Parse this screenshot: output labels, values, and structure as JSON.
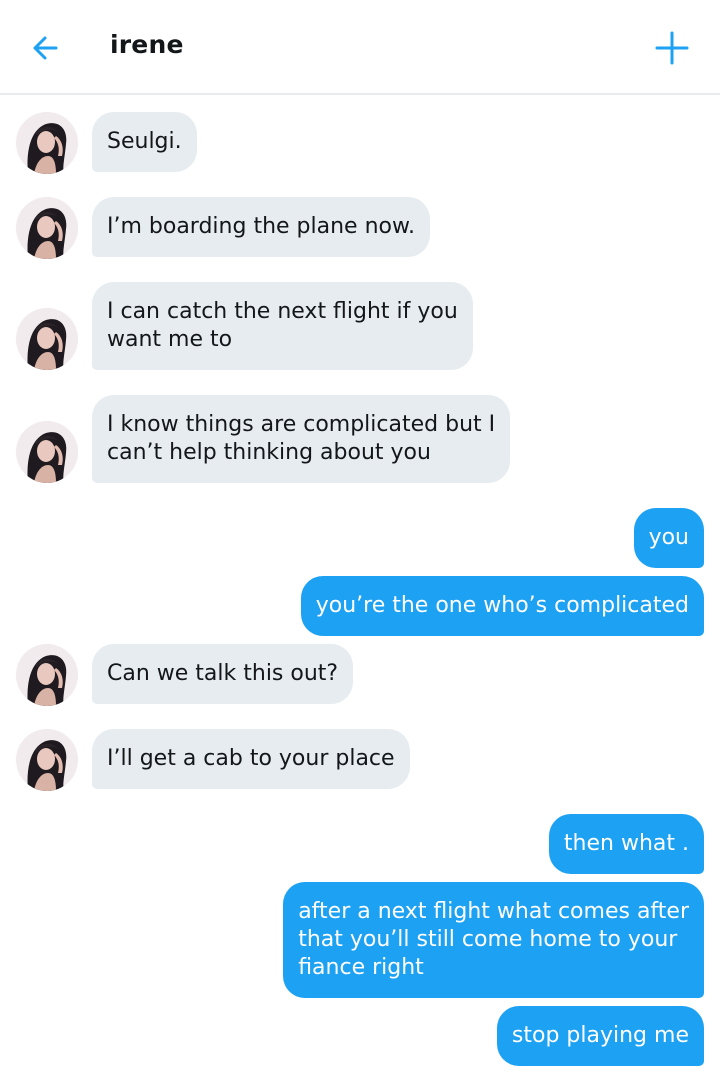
{
  "header": {
    "back_icon": "arrow-left-icon",
    "title": "irene",
    "add_icon": "plus-icon",
    "accent_color": "#1da1f2"
  },
  "colors": {
    "incoming_bubble": "#e6ecf0",
    "outgoing_bubble": "#1da1f2",
    "incoming_text": "#14171a",
    "outgoing_text": "#ffffff"
  },
  "messages": [
    {
      "sender": "irene",
      "text": "Seulgi."
    },
    {
      "sender": "irene",
      "text": "I’m boarding the plane now."
    },
    {
      "sender": "irene",
      "text": "I can catch the next flight if you\nwant me to"
    },
    {
      "sender": "irene",
      "text": "I know things are complicated but I\ncan’t help thinking about you"
    },
    {
      "sender": "me",
      "text": "you"
    },
    {
      "sender": "me",
      "text": "you’re the one who’s complicated"
    },
    {
      "sender": "irene",
      "text": "Can we talk this out?"
    },
    {
      "sender": "irene",
      "text": "I’ll get a cab to your place"
    },
    {
      "sender": "me",
      "text": "then what ."
    },
    {
      "sender": "me",
      "text": "after a next flight what comes after\nthat you’ll still come home to your\nfiance right"
    },
    {
      "sender": "me",
      "text": "stop playing me"
    }
  ]
}
